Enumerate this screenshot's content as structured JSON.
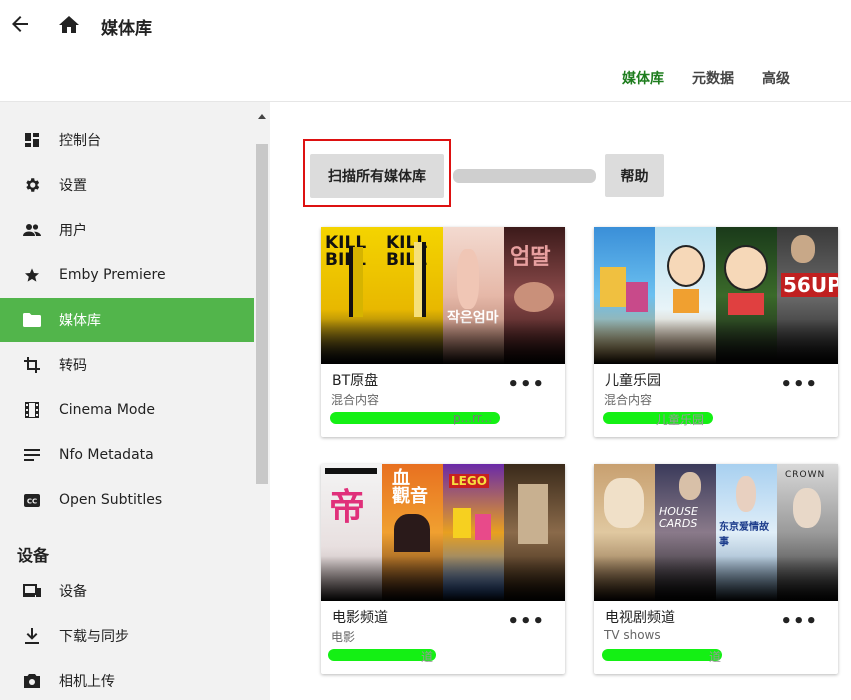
{
  "header": {
    "title": "媒体库",
    "tabs": [
      {
        "label": "媒体库",
        "active": true
      },
      {
        "label": "元数据",
        "active": false
      },
      {
        "label": "高级",
        "active": false
      }
    ]
  },
  "sidebar": {
    "items": [
      {
        "label": "控制台",
        "icon": "dashboard-icon"
      },
      {
        "label": "设置",
        "icon": "gear-icon"
      },
      {
        "label": "用户",
        "icon": "people-icon"
      },
      {
        "label": "Emby Premiere",
        "icon": "star-icon"
      },
      {
        "label": "媒体库",
        "icon": "folder-icon",
        "active": true
      },
      {
        "label": "转码",
        "icon": "crop-icon"
      },
      {
        "label": "Cinema Mode",
        "icon": "film-icon"
      },
      {
        "label": "Nfo Metadata",
        "icon": "lines-icon"
      },
      {
        "label": "Open Subtitles",
        "icon": "cc-icon"
      }
    ],
    "devices_section": "设备",
    "device_items": [
      {
        "label": "设备",
        "icon": "devices-icon"
      },
      {
        "label": "下载与同步",
        "icon": "download-icon"
      },
      {
        "label": "相机上传",
        "icon": "camera-icon"
      }
    ]
  },
  "main": {
    "scan_label": "扫描所有媒体库",
    "help_label": "帮助",
    "libraries": [
      {
        "title": "BT原盘",
        "subtitle": "混合内容",
        "path_visible": "p...rr..."
      },
      {
        "title": "儿童乐园",
        "subtitle": "混合内容",
        "path_visible": "儿童乐园"
      },
      {
        "title": "电影频道",
        "subtitle": "电影",
        "path_visible": "道"
      },
      {
        "title": "电视剧频道",
        "subtitle": "TV shows",
        "path_visible": "道"
      }
    ],
    "poster_texts": {
      "kill_bill": "KILL BILL",
      "56up": "56UP",
      "house_of_cards": "HOUSE CARDS",
      "crown": "CROWN",
      "tokyo": "东京爱情故事"
    }
  },
  "colors": {
    "accent": "#52b54b",
    "active_tab": "#1e7d1e",
    "highlight_border": "#d11111",
    "redaction": "#14f014"
  }
}
